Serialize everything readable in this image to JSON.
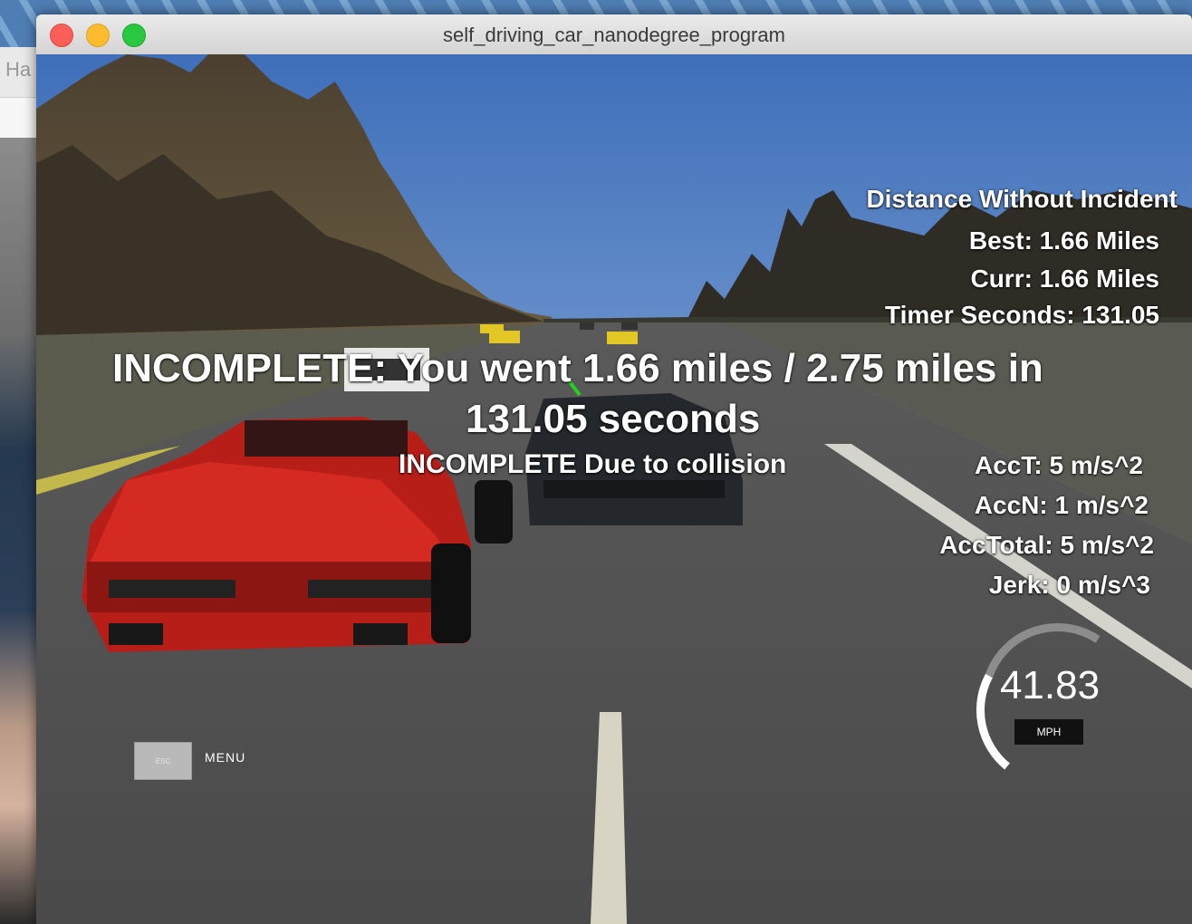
{
  "window": {
    "title": "self_driving_car_nanodegree_program"
  },
  "background_window": {
    "title_fragment": "Ha"
  },
  "hud": {
    "distance_header": "Distance Without Incident",
    "best": "Best: 1.66 Miles",
    "curr": "Curr: 1.66 Miles",
    "timer": "Timer Seconds: 131.05",
    "result_line1": "INCOMPLETE: You went 1.66 miles / 2.75 miles in",
    "result_line2": "131.05 seconds",
    "result_reason": "INCOMPLETE Due to collision",
    "acc_t": "AccT: 5 m/s^2",
    "acc_n": "AccN: 1 m/s^2",
    "acc_total": "AccTotal: 5 m/s^2",
    "jerk": "Jerk: 0 m/s^3"
  },
  "speedometer": {
    "value": "41.83",
    "unit": "MPH"
  },
  "menu": {
    "esc_label": "ESC",
    "menu_label": "MENU"
  }
}
